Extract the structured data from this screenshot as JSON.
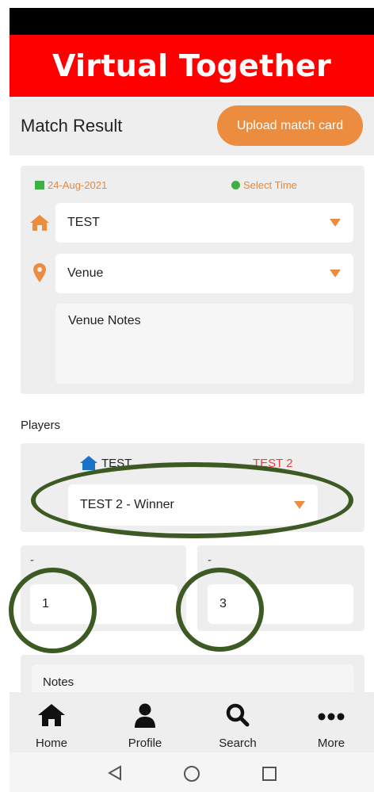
{
  "banner": {
    "title": "Virtual Together"
  },
  "header": {
    "title": "Match Result",
    "upload_label": "Upload match card"
  },
  "match": {
    "date": "24-Aug-2021",
    "time_label": "Select Time",
    "home_team": "TEST",
    "venue": "Venue",
    "venue_notes_placeholder": "Venue Notes"
  },
  "players": {
    "label": "Players",
    "home_team": "TEST",
    "away_team": "TEST 2",
    "result": "TEST 2 - Winner",
    "left_dash": "-",
    "right_dash": "-",
    "home_score": "1",
    "away_score": "3"
  },
  "notes": {
    "label": "Notes"
  },
  "nav": {
    "items": [
      {
        "label": "Home",
        "icon": "home-icon"
      },
      {
        "label": "Profile",
        "icon": "person-icon"
      },
      {
        "label": "Search",
        "icon": "search-icon"
      },
      {
        "label": "More",
        "icon": "more-icon"
      }
    ]
  },
  "colors": {
    "brand_red": "#ff0000",
    "accent_orange": "#ec8c3f",
    "annotation_green": "#3e5a24",
    "away_red": "#ef4040"
  }
}
